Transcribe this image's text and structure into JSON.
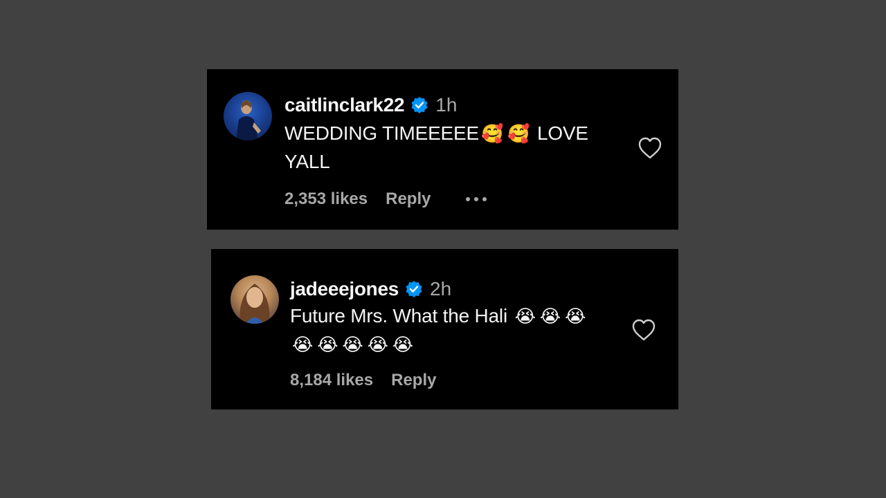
{
  "comments": [
    {
      "username": "caitlinclark22",
      "time": "1h",
      "text_line1": "WEDDING TIMEEEEE",
      "emoji_a": "🥰",
      "emoji_b": "🥰",
      "text_line1_end": "LOVE",
      "text_line2": "YALL",
      "likes": "2,353 likes",
      "reply": "Reply",
      "more": "•••"
    },
    {
      "username": "jadeeejones",
      "time": "2h",
      "text_line1": "Future Mrs. What the Hali",
      "line1_emojis": [
        "😭",
        "😭",
        "😭"
      ],
      "line2_emojis": [
        "😭",
        "😭",
        "😭",
        "😭",
        "😭"
      ],
      "likes": "8,184 likes",
      "reply": "Reply"
    }
  ],
  "colors": {
    "page_background": "#414141",
    "card_background": "#000000",
    "verified_blue": "#0095f6",
    "secondary_text": "#a8a8a8"
  }
}
